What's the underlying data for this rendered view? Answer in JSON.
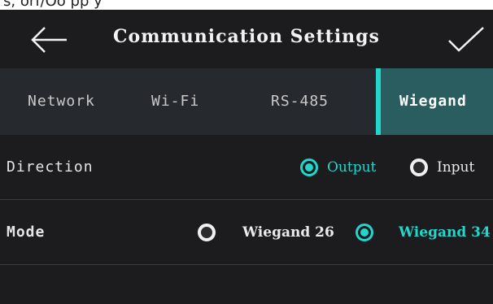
{
  "status_strip": "s, orf/Oo pp y",
  "header": {
    "title": "Communication Settings",
    "back_icon": "back-arrow-icon",
    "confirm_icon": "checkmark-icon"
  },
  "tabs": [
    {
      "label": "Network",
      "active": false
    },
    {
      "label": "Wi-Fi",
      "active": false
    },
    {
      "label": "RS-485",
      "active": false
    },
    {
      "label": "Wiegand",
      "active": true
    }
  ],
  "settings": {
    "direction": {
      "label": "Direction",
      "options": [
        {
          "label": "Output",
          "selected": true
        },
        {
          "label": "Input",
          "selected": false
        }
      ]
    },
    "mode": {
      "label": "Mode",
      "options": [
        {
          "label": "Wiegand 26",
          "selected": false
        },
        {
          "label": "Wiegand 34",
          "selected": true
        }
      ]
    }
  },
  "colors": {
    "accent": "#22d6cc",
    "background": "#1c1c1f",
    "tab_bar": "#262a2e",
    "active_tab": "#2a5d60"
  }
}
